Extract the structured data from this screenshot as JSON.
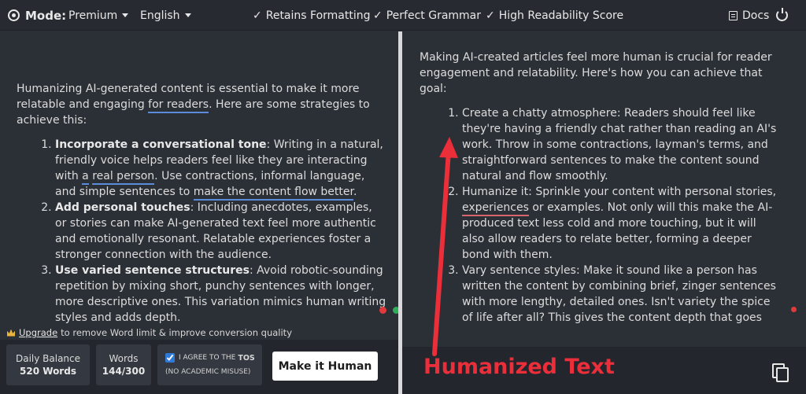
{
  "topbar": {
    "mode_label": "Mode:",
    "mode_value": "Premium",
    "language_value": "English",
    "features": [
      "Retains Formatting",
      "Perfect Grammar",
      "High Readability Score"
    ],
    "docs_label": "Docs"
  },
  "left": {
    "intro_1": "Humanizing AI-generated content is essential to make it more relatable and engaging ",
    "intro_link": "for readers",
    "intro_2": ". Here are some strategies to achieve this:",
    "items": [
      {
        "title": "Incorporate a conversational tone",
        "p1": ": Writing in a natural, friendly voice helps readers feel like they are interacting with ",
        "u1": "a",
        "p2": " ",
        "u2": "real person",
        "p3": ". Use contractions, informal language, and simple sentences to ",
        "u3": "make the content flow better",
        "p4": "."
      },
      {
        "title": "Add personal touches",
        "text": ": Including anecdotes, examples, or stories can make AI-generated text feel more authentic and emotionally resonant. Relatable experiences foster a stronger connection with the audience."
      },
      {
        "title": "Use varied sentence structures",
        "text": ": Avoid robotic-sounding repetition by mixing short, punchy sentences with longer, more descriptive ones. This variation mimics human writing styles and adds depth."
      }
    ]
  },
  "right": {
    "intro": "Making AI-created articles feel more human is crucial for reader engagement and relatability. Here's how you can achieve that goal:",
    "items": [
      {
        "text": "Create a chatty atmosphere: Readers should feel like they're having a friendly chat rather than reading an AI's work. Throw in some contractions, layman's terms, and straightforward sentences to make the content sound natural and flow smoothly."
      },
      {
        "p1": "Humanize it: Sprinkle your content with personal stories, ",
        "u1": "experiences",
        "p2": " or examples. Not only will this make the AI-produced text less cold and more touching, but it will also allow readers to relate better, forming a deeper bond with them."
      },
      {
        "text": "Vary sentence styles: Make it sound like a person has written the content by combining brief, zinger sentences with more lengthy, detailed ones. Isn't variety the spice of life after all? This gives the content depth that goes"
      }
    ]
  },
  "bottom": {
    "upgrade_link": "Upgrade",
    "upgrade_text": "to remove Word limit & improve conversion quality",
    "daily_balance_label": "Daily Balance",
    "daily_balance_value": "520 Words",
    "words_label": "Words",
    "words_value": "144/300",
    "agree_prefix": "I AGREE TO THE",
    "agree_tos": "TOS",
    "agree_note": "(NO ACADEMIC MISUSE)",
    "make_button": "Make it Human",
    "humanized_label": "Humanized Text"
  },
  "colors": {
    "annotation_red": "#ea2e3a",
    "underline_blue": "#5b8bd9",
    "underline_red": "#d9646c"
  }
}
